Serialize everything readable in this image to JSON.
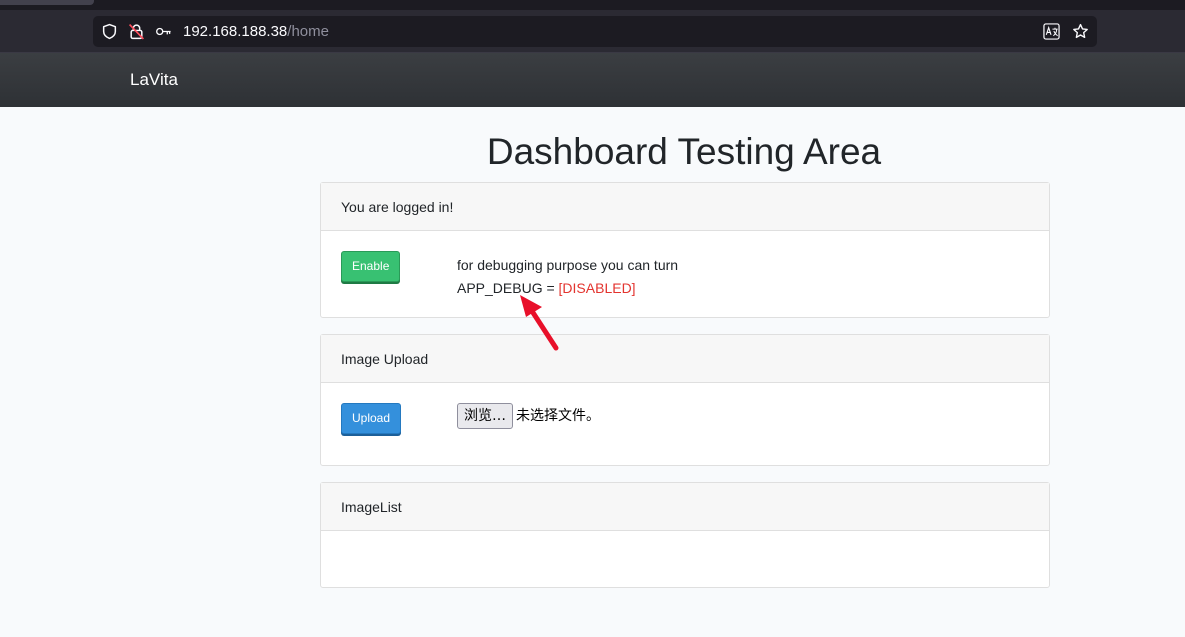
{
  "browser": {
    "url_host": "192.168.188.38",
    "url_path": "/home",
    "icons": [
      "shield-icon",
      "lock-insecure-icon",
      "key-icon",
      "translate-icon",
      "bookmark-star-icon"
    ]
  },
  "navbar": {
    "brand": "LaVita"
  },
  "page": {
    "title": "Dashboard Testing Area"
  },
  "cards": {
    "login": {
      "header": "You are logged in!",
      "button": "Enable",
      "line1": "for debugging purpose you can turn",
      "line2_prefix": "APP_DEBUG = ",
      "line2_status": "[DISABLED]"
    },
    "upload": {
      "header": "Image Upload",
      "button": "Upload",
      "file_button": "浏览…",
      "file_status": "未选择文件。"
    },
    "imagelist": {
      "header": "ImageList"
    }
  },
  "colors": {
    "success": "#38c172",
    "primary": "#3490dc",
    "danger": "#e3342f",
    "annotation_arrow": "#e8102a"
  }
}
